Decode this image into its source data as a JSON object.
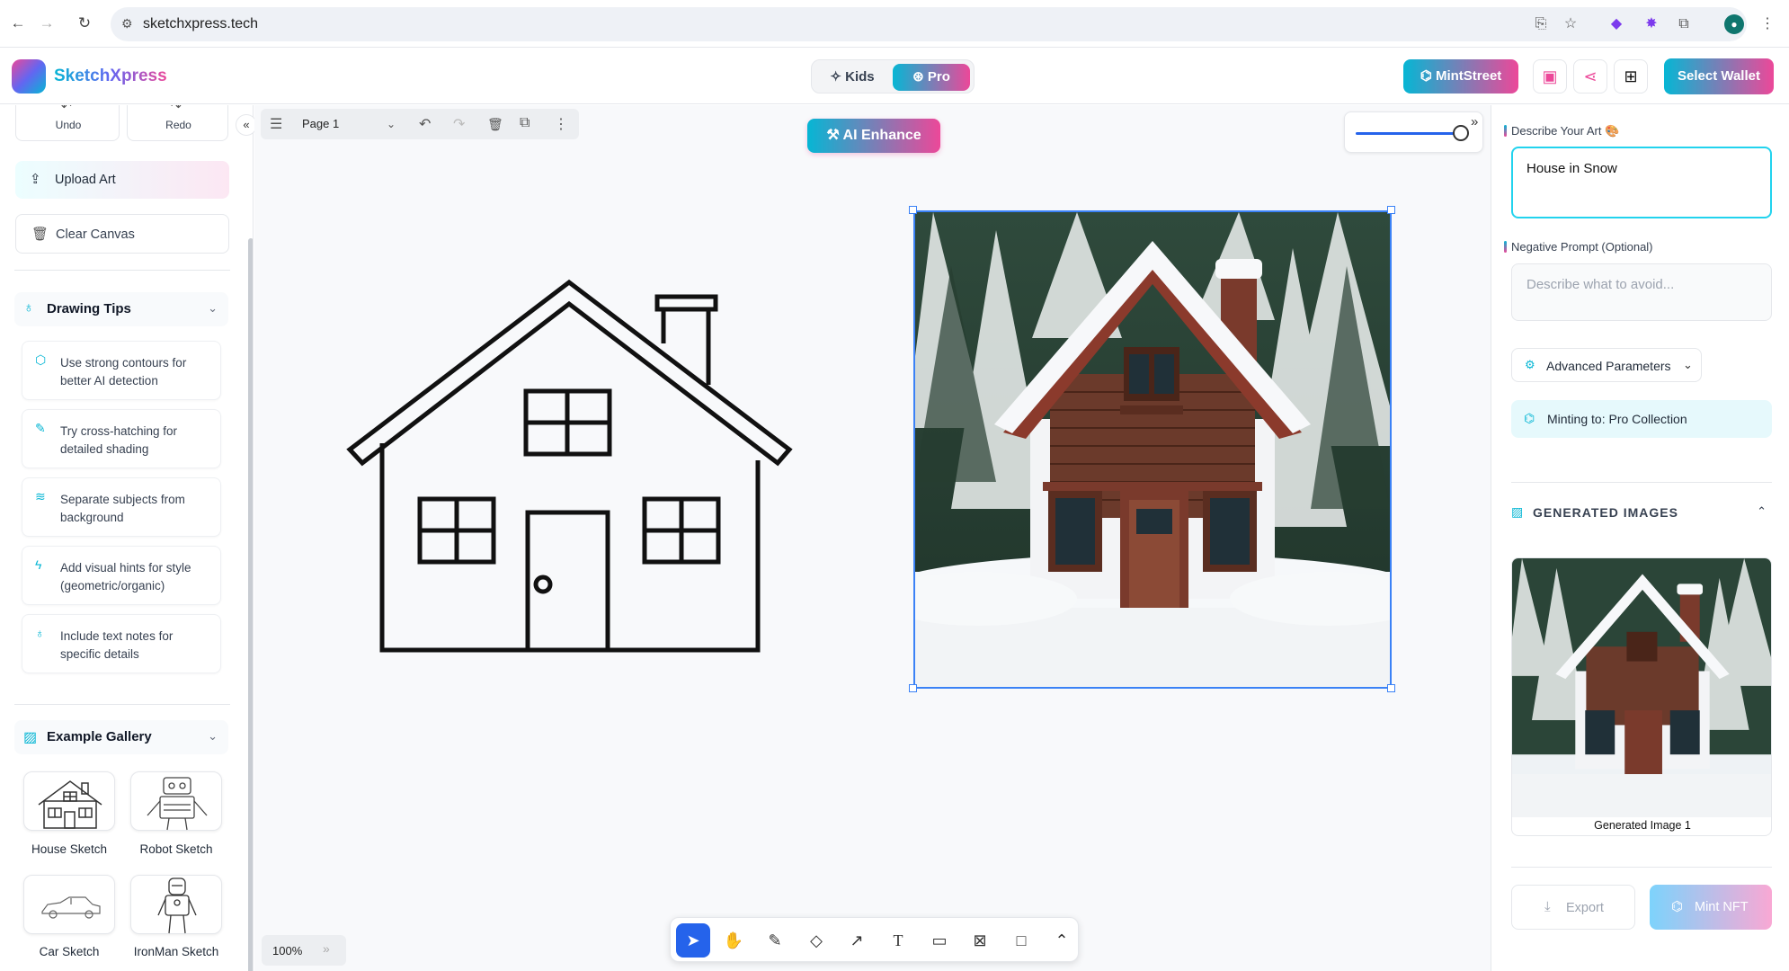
{
  "browser": {
    "url": "sketchxpress.tech"
  },
  "header": {
    "brand": "SketchXpress",
    "mode_kids": "Kids",
    "mode_pro": "Pro",
    "mintstreet": "MintStreet",
    "select_wallet": "Select Wallet"
  },
  "sidebar": {
    "undo": "Undo",
    "redo": "Redo",
    "upload_art": "Upload Art",
    "clear_canvas": "Clear Canvas",
    "tips_title": "Drawing Tips",
    "tips": [
      {
        "text": "Use strong contours for better AI detection",
        "icon": "tag-icon"
      },
      {
        "text": "Try cross-hatching for detailed shading",
        "icon": "pencil-icon"
      },
      {
        "text": "Separate subjects from background",
        "icon": "layers-icon"
      },
      {
        "text": "Add visual hints for style (geometric/organic)",
        "icon": "zap-icon"
      },
      {
        "text": "Include text notes for specific details",
        "icon": "lightbulb-icon"
      }
    ],
    "gallery_title": "Example Gallery",
    "gallery": [
      {
        "label": "House Sketch"
      },
      {
        "label": "Robot Sketch"
      },
      {
        "label": "Car Sketch"
      },
      {
        "label": "IronMan Sketch"
      }
    ]
  },
  "canvas": {
    "page_name": "Page 1",
    "ai_enhance": "AI Enhance",
    "zoom": "100%"
  },
  "right": {
    "describe_label": "Describe Your Art 🎨",
    "describe_value": "House in Snow",
    "negative_label": "Negative Prompt (Optional)",
    "negative_placeholder": "Describe what to avoid...",
    "advanced": "Advanced Parameters",
    "minting": "Minting to: Pro Collection",
    "generated_title": "GENERATED IMAGES",
    "generated_caption": "Generated Image 1",
    "export": "Export",
    "mint_nft": "Mint NFT"
  },
  "colors": {
    "accent_cyan": "#06b6d4",
    "accent_pink": "#ec4899",
    "selection_blue": "#3b82f6"
  }
}
